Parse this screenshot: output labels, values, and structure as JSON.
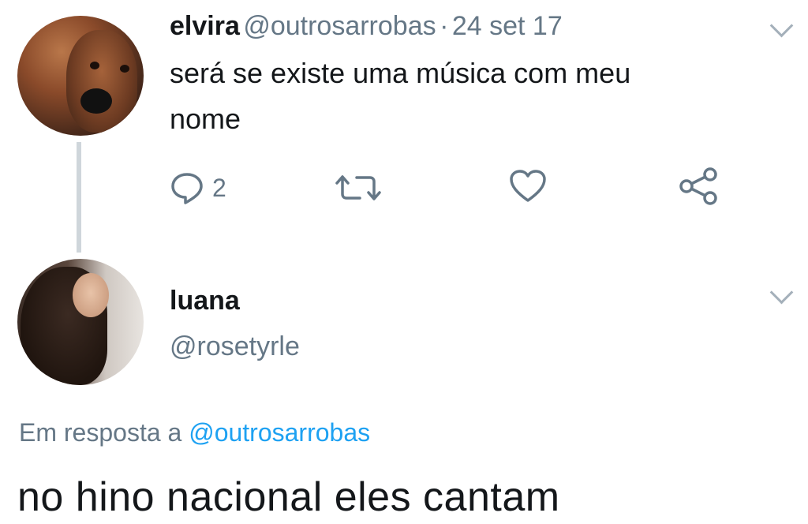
{
  "tweet1": {
    "name": "elvira",
    "handle": "@outrosarrobas",
    "separator": "·",
    "date": "24 set 17",
    "text_line1": "será se existe uma música com meu",
    "text_line2": "nome",
    "reply_count": "2"
  },
  "tweet2": {
    "name": "luana",
    "handle": "@rosetyrle",
    "reply_prefix": "Em resposta a",
    "reply_mention": "@outrosarrobas",
    "text": "no hino nacional eles cantam"
  },
  "icons": {
    "reply": "speech-bubble-icon",
    "retweet": "retweet-icon",
    "like": "heart-icon",
    "share": "share-icon",
    "menu": "chevron-down-icon"
  },
  "colors": {
    "text": "#14171a",
    "secondary": "#657786",
    "link": "#1da1f2",
    "thread_line": "#cfd6db"
  }
}
